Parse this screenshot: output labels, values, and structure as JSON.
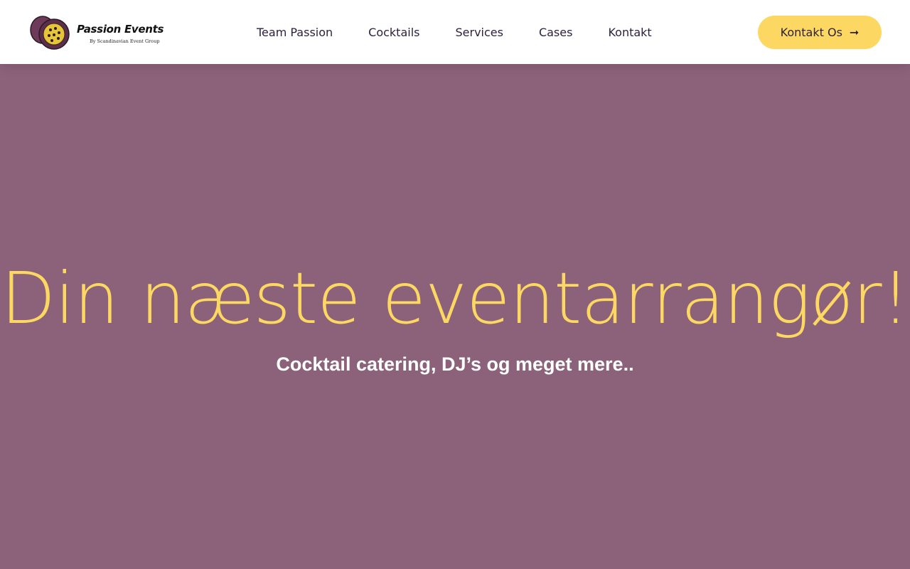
{
  "header": {
    "logo": {
      "name": "Passion Events",
      "tagline": "By Scandinavian Event Group"
    },
    "nav": [
      {
        "label": "Team Passion"
      },
      {
        "label": "Cocktails"
      },
      {
        "label": "Services"
      },
      {
        "label": "Cases"
      },
      {
        "label": "Kontakt"
      }
    ],
    "cta": {
      "label": "Kontakt Os",
      "icon": "arrow-right-icon"
    }
  },
  "hero": {
    "title": "Din næste eventarrangør!",
    "subtitle": "Cocktail catering, DJ’s og meget mere.."
  },
  "colors": {
    "background": "#8c627a",
    "accent": "#fcd862",
    "header_bg": "#ffffff",
    "nav_text": "#2a1f3d"
  }
}
